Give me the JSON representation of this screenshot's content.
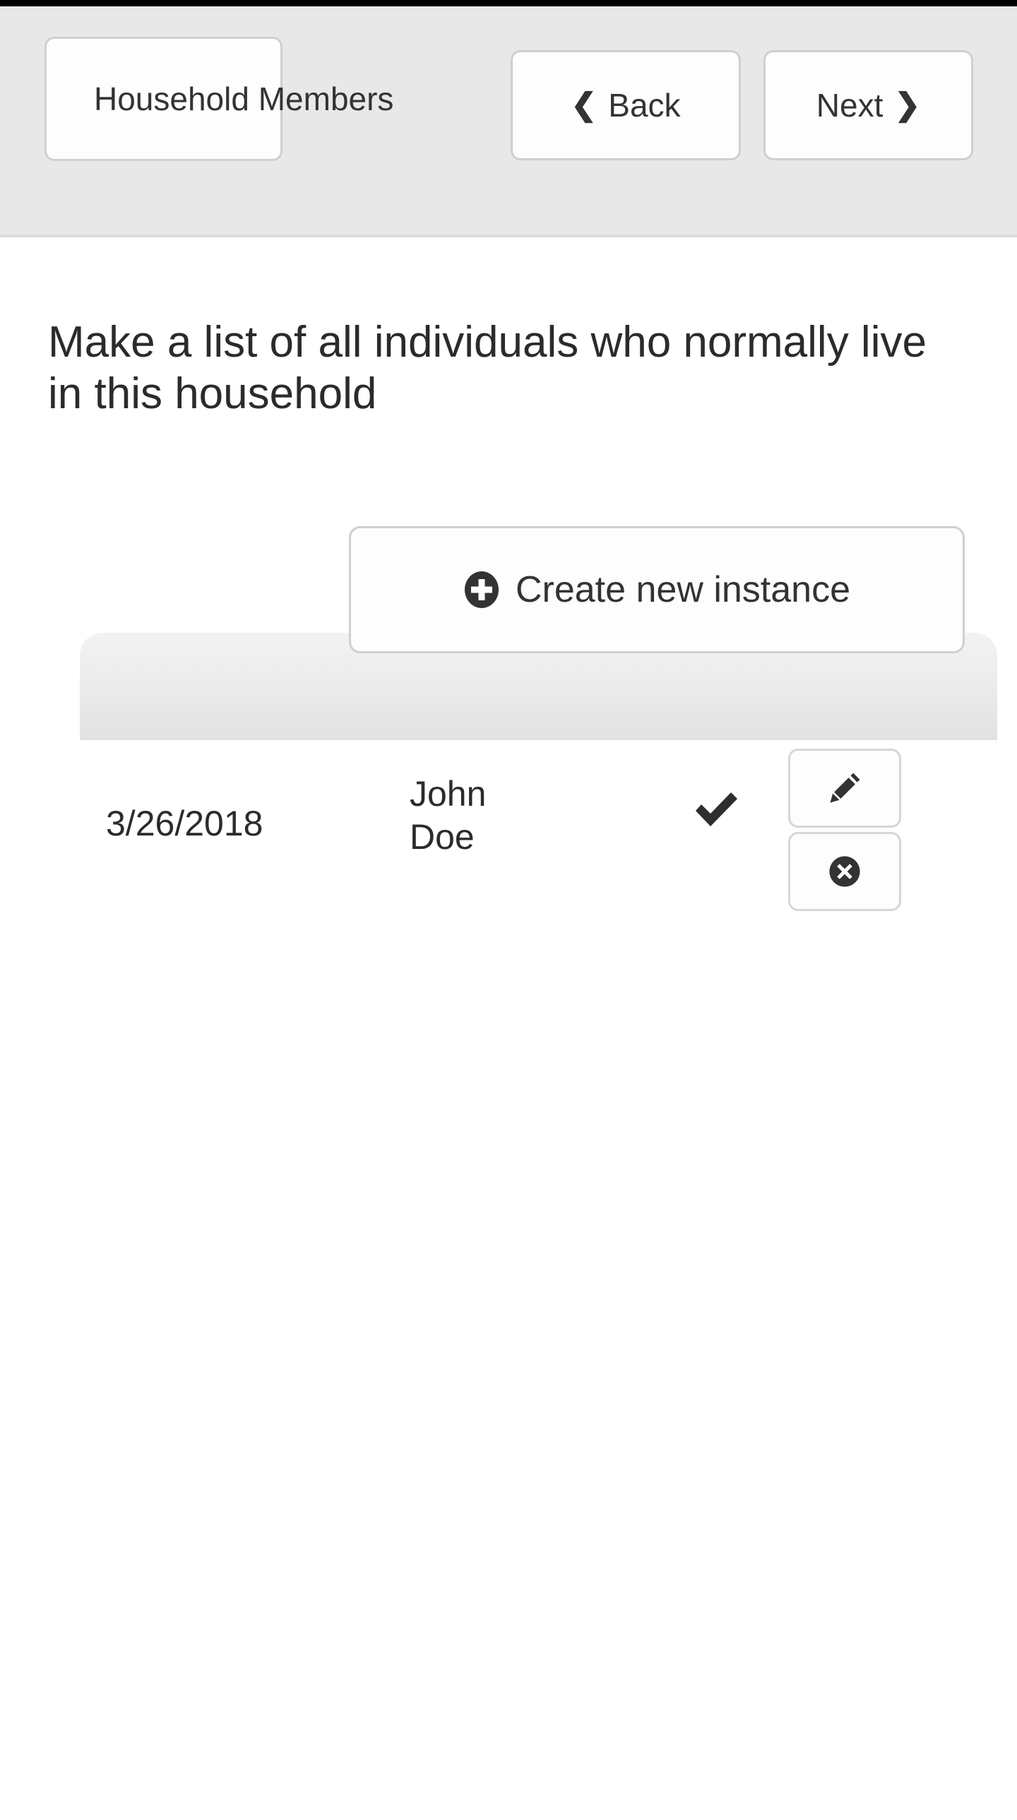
{
  "window": {
    "status_strip_color": "#000000",
    "toolbar_bg": "#e8e8e8",
    "content_bg": "#ffffff",
    "accent_dark": "#333333"
  },
  "toolbar": {
    "title": "Household Members",
    "back_label": "Back",
    "next_label": "Next",
    "back_icon": "chevron-left-icon",
    "next_icon": "chevron-right-icon",
    "back_glyph": "❮",
    "next_glyph": "❯"
  },
  "main": {
    "prompt": "Make a list of all individuals who normally live in this household",
    "create_button": {
      "label": "Create new instance",
      "icon": "plus-circle-icon"
    },
    "table": {
      "header_columns": [
        "",
        "",
        "",
        ""
      ],
      "rows": [
        {
          "date": "3/26/2018",
          "name": "John Doe",
          "complete_icon": "checkmark-icon",
          "complete_glyph": "✔",
          "edit_icon": "pencil-icon",
          "delete_icon": "remove-circle-icon"
        }
      ]
    }
  }
}
